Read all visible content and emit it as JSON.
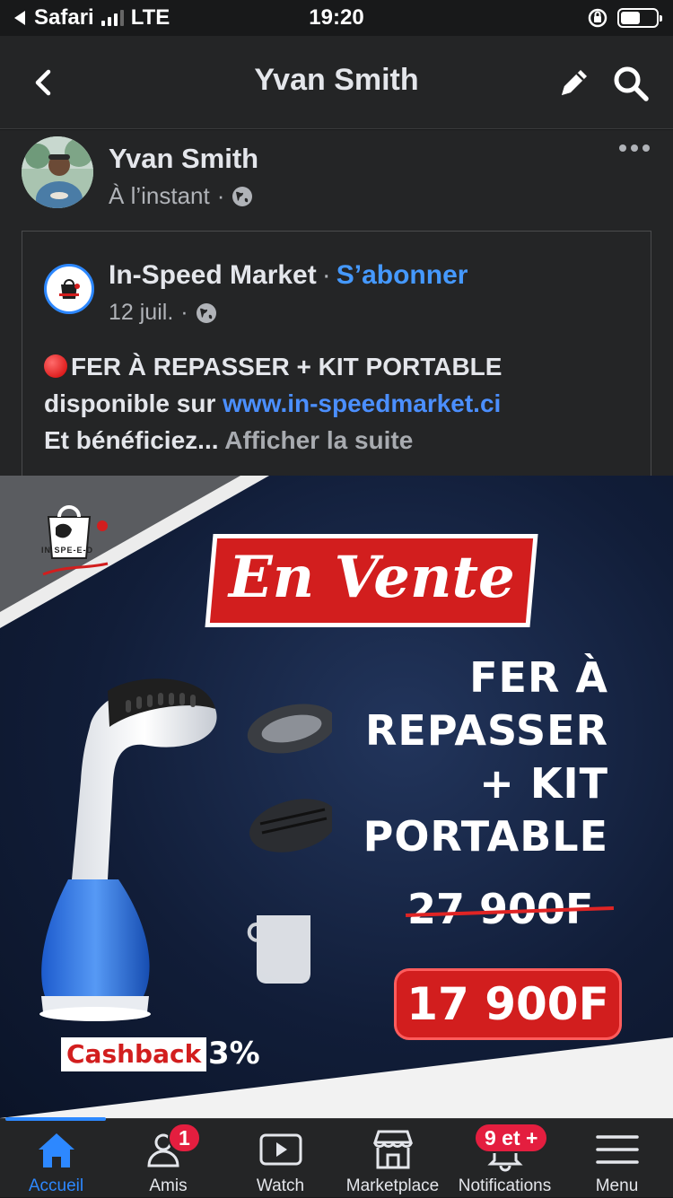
{
  "status_bar": {
    "carrier_back": "Safari",
    "network": "LTE",
    "time": "19:20"
  },
  "topnav": {
    "title": "Yvan Smith"
  },
  "post": {
    "author": "Yvan Smith",
    "timestamp": "À l’instant",
    "privacy_icon": "globe-icon",
    "shared": {
      "page_name": "In-Speed Market",
      "separator": "·",
      "follow_label": "S’abonner",
      "date": "12 juil.",
      "dot": "·",
      "line1": "FER À REPASSER + KIT PORTABLE",
      "line2_prefix": "disponible sur ",
      "link": "www.in-speedmarket.ci",
      "line3_prefix": "Et bénéficiez...",
      "see_more": "Afficher la suite"
    }
  },
  "ad": {
    "logo_text": "IN SPE-E-D",
    "banner": "En Vente",
    "headline_1": "FER À",
    "headline_2": "REPASSER",
    "headline_3": "+ KIT",
    "headline_4": "PORTABLE",
    "old_price": "27 900F",
    "new_price": "17 900F",
    "cashback_label": "Cashback",
    "cashback_value": "3%"
  },
  "tabbar": {
    "active_color": "#2d88ff",
    "tabs": [
      {
        "label": "Accueil",
        "icon": "home-icon"
      },
      {
        "label": "Amis",
        "icon": "friends-icon",
        "badge": "1"
      },
      {
        "label": "Watch",
        "icon": "watch-icon"
      },
      {
        "label": "Marketplace",
        "icon": "marketplace-icon"
      },
      {
        "label": "Notifications",
        "icon": "bell-icon",
        "badge": "9 et +"
      },
      {
        "label": "Menu",
        "icon": "menu-icon"
      }
    ]
  }
}
